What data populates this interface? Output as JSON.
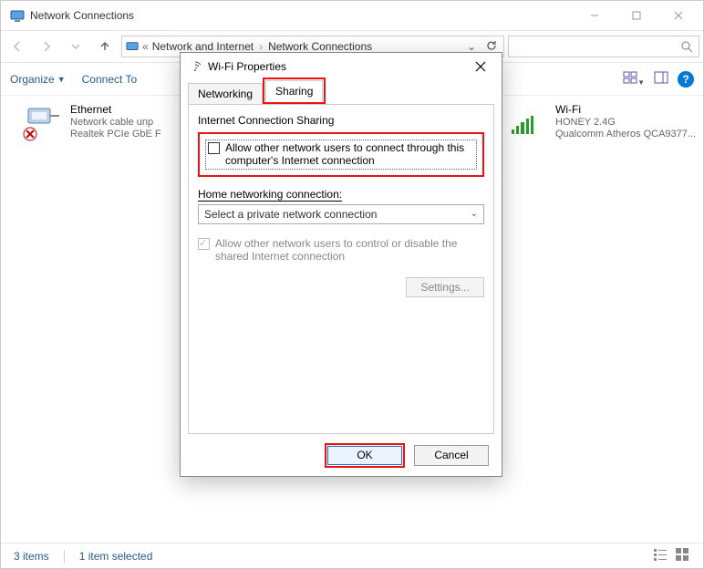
{
  "window": {
    "title": "Network Connections",
    "breadcrumb": [
      "Network and Internet",
      "Network Connections"
    ]
  },
  "commandbar": {
    "organize": "Organize",
    "connect": "Connect To"
  },
  "adapters": {
    "ethernet": {
      "name": "Ethernet",
      "line1": "Network cable unp",
      "line2": "Realtek PCIe GbE F"
    },
    "wifi": {
      "name": "Wi-Fi",
      "line1": "HONEY 2.4G",
      "line2": "Qualcomm Atheros QCA9377..."
    }
  },
  "status": {
    "items": "3 items",
    "selected": "1 item selected"
  },
  "dialog": {
    "title": "Wi-Fi Properties",
    "tabs": {
      "networking": "Networking",
      "sharing": "Sharing"
    },
    "group": "Internet Connection Sharing",
    "allow_label": "Allow other network users to connect through this computer's Internet connection",
    "home_label": "Home networking connection:",
    "combo_value": "Select a private network connection",
    "disabled_label": "Allow other network users to control or disable the shared Internet connection",
    "settings_btn": "Settings...",
    "ok": "OK",
    "cancel": "Cancel"
  }
}
